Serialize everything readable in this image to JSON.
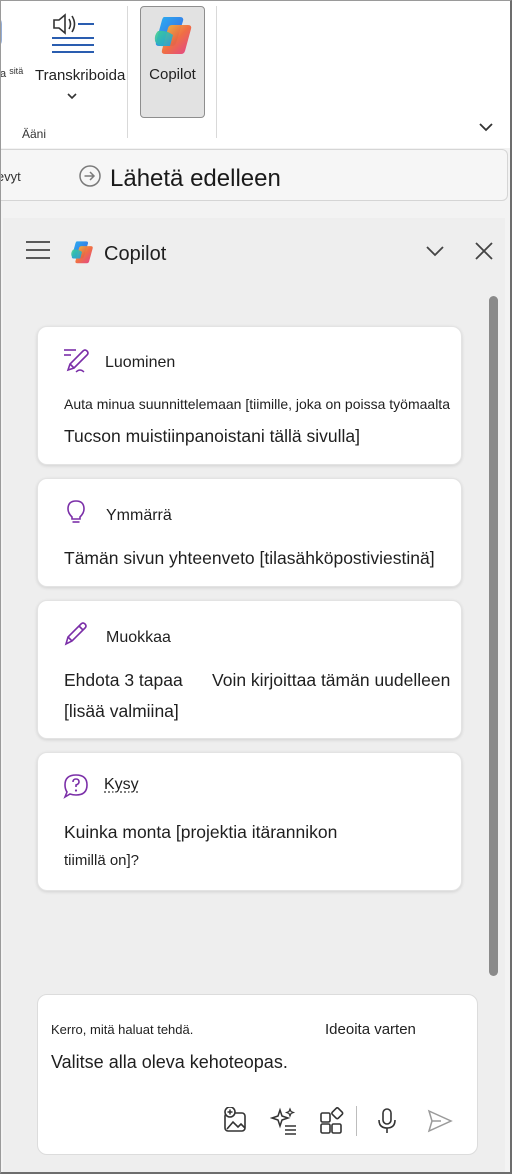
{
  "ribbon": {
    "partial_button_label": "a",
    "partial_button_label_small": "sitä",
    "transcribe_label": "Transkriboida",
    "group_label": "Ääni",
    "copilot_label": "Copilot"
  },
  "toolbar": {
    "partial_label": "levyt",
    "send_label": "Lähetä edelleen"
  },
  "pane": {
    "title": "Copilot"
  },
  "cards": [
    {
      "title": "Luominen",
      "icon": "pen-sparkle-icon",
      "line1": "Auta minua suunnittelemaan [tiimille, joka on poissa työmaalta",
      "line2": "Tucson muistiinpanoistani tällä sivulla]"
    },
    {
      "title": "Ymmärrä",
      "icon": "lightbulb-icon",
      "line1": "Tämän sivun yhteenveto [tilasähköpostiviestinä]"
    },
    {
      "title": "Muokkaa",
      "icon": "pencil-icon",
      "line1": "Ehdota 3 tapaa",
      "line1b": "Voin kirjoittaa tämän uudelleen",
      "line2": "[lisää valmiina]"
    },
    {
      "title": "Kysy",
      "icon": "question-bubble-icon",
      "line1": "Kuinka monta [projektia itärannikon",
      "line2": "tiimillä on]?"
    }
  ],
  "composer": {
    "hint": "Kerro, mitä haluat tehdä.",
    "ideas": "Ideoita varten",
    "placeholder": "Valitse alla oleva kehoteopas."
  },
  "colors": {
    "accent_purple": "#7b2fa8",
    "pane_bg": "#eeeeee",
    "card_bg": "#ffffff"
  }
}
